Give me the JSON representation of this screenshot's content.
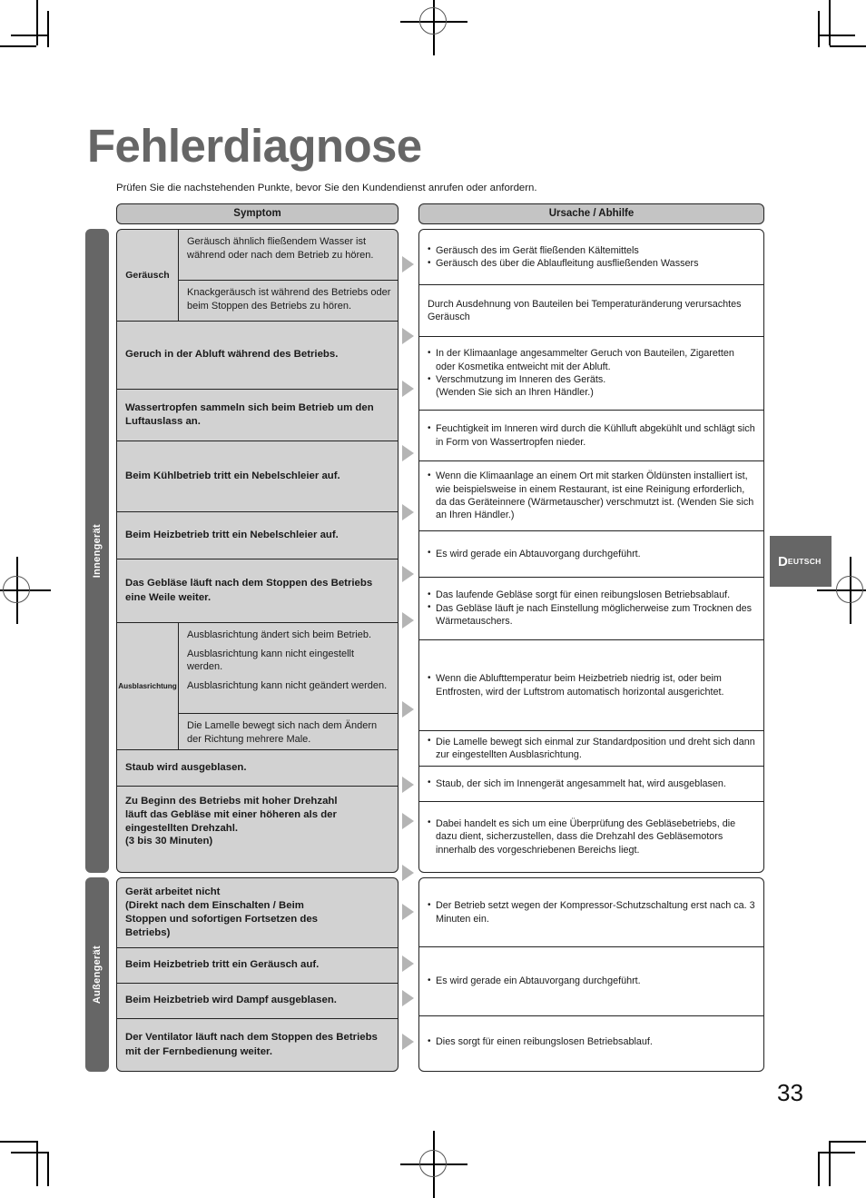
{
  "page": {
    "title": "Fehlerdiagnose",
    "intro": "Prüfen Sie die nachstehenden Punkte, bevor Sie den Kundendienst anrufen oder anfordern.",
    "number": "33",
    "language_tab": {
      "first_letter": "D",
      "rest": "EUTSCH"
    }
  },
  "table": {
    "headers": {
      "symptom": "Symptom",
      "cause": "Ursache / Abhilfe"
    }
  },
  "sections": [
    {
      "side_label": "Innengerät",
      "symptom_rows": {
        "noise_group_label": "Geräusch",
        "noise_sub_1": "Geräusch ähnlich fließendem Wasser ist während oder nach dem Betrieb zu hören.",
        "noise_sub_2": "Knackgeräusch ist während des Betriebs oder beim Stoppen des Betriebs zu hören.",
        "smell": "Geruch in der Abluft während des Betriebs.",
        "water_drops": "Wassertropfen sammeln sich beim Betrieb um den Luftauslass an.",
        "cool_mist": "Beim Kühlbetrieb tritt ein Nebelschleier auf.",
        "heat_mist": "Beim Heizbetrieb tritt ein Nebelschleier auf.",
        "fan_runs_on": "Das Gebläse läuft nach dem Stoppen des Betriebs eine Weile weiter.",
        "airflow_group_label": "Ausblasrichtung",
        "airflow_sub_1": "Ausblasrichtung ändert sich beim Betrieb.",
        "airflow_sub_2": "Ausblasrichtung kann nicht eingestellt werden.",
        "airflow_sub_3": "Ausblasrichtung kann nicht geändert werden.",
        "airflow_sub_4": "Die Lamelle bewegt sich nach dem Ändern der Richtung mehrere Male.",
        "dust": "Staub wird ausgeblasen.",
        "high_speed_1": "Zu Beginn des Betriebs mit hoher Drehzahl",
        "high_speed_2": "läuft das Gebläse mit einer höheren als der",
        "high_speed_3": "eingestellten Drehzahl.",
        "high_speed_4": "(3 bis 30 Minuten)"
      },
      "cause_cells": [
        {
          "lines": [
            {
              "bullet": true,
              "text": "Geräusch des im Gerät fließenden Kältemittels"
            },
            {
              "bullet": true,
              "text": "Geräusch des über die Ablaufleitung ausfließenden Wassers"
            }
          ]
        },
        {
          "lines": [
            {
              "bullet": false,
              "text": "Durch Ausdehnung von Bauteilen bei Temperaturänderung verursachtes Geräusch"
            }
          ]
        },
        {
          "lines": [
            {
              "bullet": true,
              "text": "In der Klimaanlage angesammelter Geruch von Bauteilen, Zigaretten oder Kosmetika entweicht mit der Abluft."
            },
            {
              "bullet": true,
              "text": "Verschmutzung im Inneren des Geräts."
            },
            {
              "bullet": false,
              "text": "(Wenden Sie sich an Ihren Händler.)"
            }
          ]
        },
        {
          "lines": [
            {
              "bullet": true,
              "text": "Feuchtigkeit im Inneren wird durch die Kühlluft abgekühlt und schlägt sich in Form von Wassertropfen nieder."
            }
          ]
        },
        {
          "lines": [
            {
              "bullet": true,
              "text": "Wenn die Klimaanlage an einem Ort mit starken Öldünsten installiert ist, wie beispielsweise in einem Restaurant, ist eine Reinigung erforderlich, da das Geräteinnere (Wärmetauscher) verschmutzt ist. (Wenden Sie sich an Ihren Händler.)"
            }
          ]
        },
        {
          "lines": [
            {
              "bullet": true,
              "text": "Es wird gerade ein Abtauvorgang durchgeführt."
            }
          ]
        },
        {
          "lines": [
            {
              "bullet": true,
              "text": "Das laufende Gebläse sorgt für einen reibungslosen Betriebsablauf."
            },
            {
              "bullet": true,
              "text": "Das Gebläse läuft je nach Einstellung möglicherweise zum Trocknen des Wärmetauschers."
            }
          ]
        },
        {
          "lines": [
            {
              "bullet": true,
              "text": "Wenn die Ablufttemperatur beim Heizbetrieb niedrig ist, oder beim Entfrosten, wird der Luftstrom automatisch horizontal ausgerichtet."
            }
          ]
        },
        {
          "lines": [
            {
              "bullet": true,
              "text": "Die Lamelle bewegt sich einmal zur Standardposition und dreht sich dann zur eingestellten Ausblasrichtung."
            }
          ]
        },
        {
          "lines": [
            {
              "bullet": true,
              "text": "Staub, der sich im Innengerät angesammelt hat, wird ausgeblasen."
            }
          ]
        },
        {
          "lines": [
            {
              "bullet": true,
              "text": "Dabei handelt es sich um eine Überprüfung des Gebläsebetriebs, die dazu dient, sicherzustellen, dass die Drehzahl des Gebläsemotors innerhalb des vorgeschriebenen Bereichs liegt."
            }
          ]
        }
      ]
    },
    {
      "side_label": "Außengerät",
      "symptom_rows": {
        "no_operation_1": "Gerät arbeitet nicht",
        "no_operation_2": "(Direkt nach dem Einschalten / Beim",
        "no_operation_3": "Stoppen und sofortigen Fortsetzen des",
        "no_operation_4": "Betriebs)",
        "heat_noise": "Beim Heizbetrieb tritt ein Geräusch auf.",
        "heat_steam": "Beim Heizbetrieb wird Dampf ausgeblasen.",
        "fan_continues": "Der Ventilator läuft nach dem Stoppen des Betriebs mit der Fernbedienung weiter."
      },
      "cause_cells": [
        {
          "lines": [
            {
              "bullet": true,
              "text": "Der Betrieb setzt wegen der Kompressor-Schutzschaltung erst nach ca. 3 Minuten ein."
            }
          ]
        },
        {
          "lines": [
            {
              "bullet": true,
              "text": "Es wird gerade ein Abtauvorgang durchgeführt."
            }
          ]
        },
        {
          "lines": [
            {
              "bullet": true,
              "text": "Dies sorgt für einen reibungslosen Betriebsablauf."
            }
          ]
        }
      ]
    }
  ],
  "colors": {
    "title_gray": "#666666",
    "header_fill": "#c4c4c4",
    "symptom_fill": "#d2d2d2",
    "arrow_gray": "#b4b4b4",
    "side_tab": "#666666"
  }
}
